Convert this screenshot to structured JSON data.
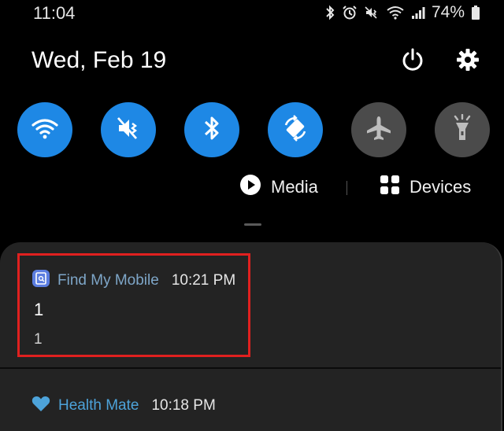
{
  "status_bar": {
    "time": "11:04",
    "battery": "74%",
    "icons": [
      "bluetooth-icon",
      "alarm-icon",
      "mute-icon",
      "wifi-icon",
      "signal-icon",
      "battery-icon"
    ]
  },
  "header": {
    "date": "Wed, Feb 19",
    "power_icon": "power-icon",
    "settings_icon": "gear-icon"
  },
  "quick_settings": [
    {
      "icon": "wifi-icon",
      "state": "on"
    },
    {
      "icon": "mute-icon",
      "state": "on"
    },
    {
      "icon": "bluetooth-icon",
      "state": "on"
    },
    {
      "icon": "auto-rotate-icon",
      "state": "on"
    },
    {
      "icon": "airplane-icon",
      "state": "off"
    },
    {
      "icon": "flashlight-icon",
      "state": "off"
    }
  ],
  "media_row": {
    "media_label": "Media",
    "devices_label": "Devices"
  },
  "notifications": [
    {
      "app": "Find My Mobile",
      "time": "10:21 PM",
      "title": "1",
      "text": "1",
      "highlighted": true
    },
    {
      "app": "Health Mate",
      "time": "10:18 PM"
    }
  ],
  "colors": {
    "background": "#000000",
    "tile_on": "#1e88e5",
    "tile_off": "#4b4b4b",
    "panel": "#232323",
    "highlight": "#e0201f",
    "app_name": "#7ea6c8",
    "health_mate": "#4da3da"
  }
}
